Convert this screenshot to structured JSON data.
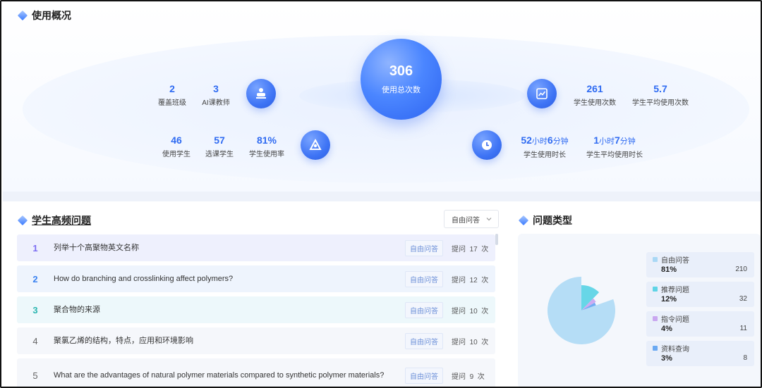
{
  "overview": {
    "title": "使用概况",
    "total": {
      "value": "306",
      "label": "使用总次数"
    },
    "left_top": [
      {
        "value": "2",
        "label": "覆盖班级"
      },
      {
        "value": "3",
        "label": "AI课教师"
      }
    ],
    "left_bottom": [
      {
        "value": "46",
        "label": "使用学生"
      },
      {
        "value": "57",
        "label": "选课学生"
      },
      {
        "value": "81%",
        "label": "学生使用率"
      }
    ],
    "right_top": [
      {
        "value": "261",
        "label": "学生使用次数"
      },
      {
        "value": "5.7",
        "label": "学生平均使用次数"
      }
    ],
    "right_bottom": [
      {
        "h": "52",
        "hu": "小时",
        "m": "6",
        "mu": "分钟",
        "label": "学生使用时长"
      },
      {
        "h": "1",
        "hu": "小时",
        "m": "7",
        "mu": "分钟",
        "label": "学生平均使用时长"
      }
    ],
    "icons": [
      "teacher-icon",
      "chart-icon",
      "students-icon",
      "clock-icon"
    ]
  },
  "questions": {
    "title": "学生高频问题",
    "dropdown": {
      "selected": "自由问答"
    },
    "rows": [
      {
        "rank": "1",
        "text": "列举十个高聚物英文名称",
        "tag": "自由问答",
        "pre": "提问",
        "count": "17",
        "unit": "次",
        "color": "#7b6cf2",
        "bg": "#eef0fd"
      },
      {
        "rank": "2",
        "text": "How do branching and crosslinking affect polymers?",
        "tag": "自由问答",
        "pre": "提问",
        "count": "12",
        "unit": "次",
        "color": "#3a82f0",
        "bg": "#eef4fd"
      },
      {
        "rank": "3",
        "text": "聚合物的来源",
        "tag": "自由问答",
        "pre": "提问",
        "count": "10",
        "unit": "次",
        "color": "#2bb6b0",
        "bg": "#edf8fb"
      },
      {
        "rank": "4",
        "text": "聚氯乙烯的结构，特点，应用和环境影响",
        "tag": "自由问答",
        "pre": "提问",
        "count": "10",
        "unit": "次",
        "color": "#666666",
        "bg": "#f5f7fb"
      },
      {
        "rank": "5",
        "text": "What are the advantages of natural polymer materials compared to synthetic polymer materials?",
        "tag": "自由问答",
        "pre": "提问",
        "count": "9",
        "unit": "次",
        "color": "#666666",
        "bg": "#f5f7fb"
      }
    ]
  },
  "types": {
    "title": "问题类型",
    "items": [
      {
        "name": "自由问答",
        "percent": "81%",
        "count": "210",
        "color": "#a9d8f5",
        "value": 210
      },
      {
        "name": "推荐问题",
        "percent": "12%",
        "count": "32",
        "color": "#5fd4e6",
        "value": 32
      },
      {
        "name": "指令问题",
        "percent": "4%",
        "count": "11",
        "color": "#c9a7f0",
        "value": 11
      },
      {
        "name": "资料查询",
        "percent": "3%",
        "count": "8",
        "color": "#6aa9f2",
        "value": 8
      }
    ]
  }
}
